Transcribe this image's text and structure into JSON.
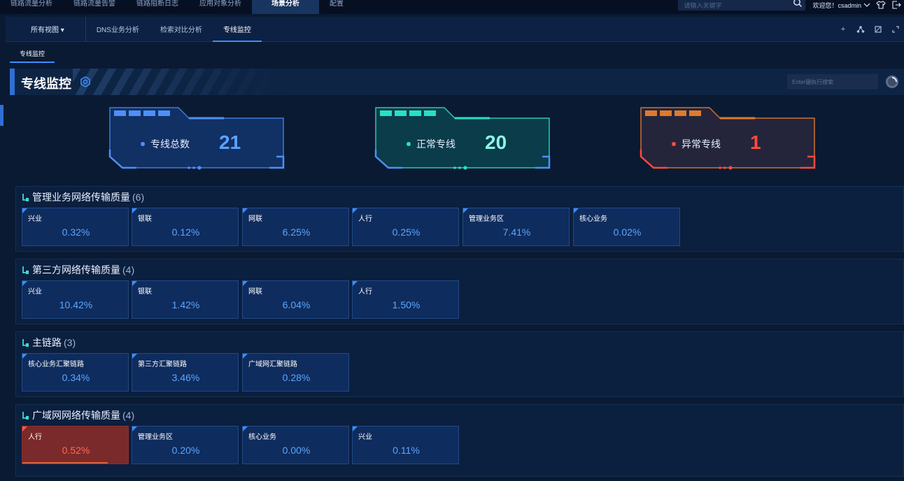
{
  "topnav": {
    "items": [
      "链路流量分析",
      "链路流量告警",
      "链路阻断日志",
      "应用对象分析",
      "场景分析",
      "配置"
    ],
    "active_index": 4,
    "search_placeholder": "请输入关键字",
    "welcome": "欢迎您！csadmin"
  },
  "viewbar": {
    "all_views": "所有视图 ▾",
    "tabs": [
      "DNS业务分析",
      "检索对比分析",
      "专线监控"
    ],
    "active_index": 2
  },
  "subtab": "专线监控",
  "page": {
    "title": "专线监控",
    "search_placeholder": "Enter键执行搜索"
  },
  "stats": [
    {
      "label": "专线总数",
      "value": "21",
      "color": "#4f8ff7",
      "value_color": "#5aa3ff",
      "fill": "#113063"
    },
    {
      "label": "正常专线",
      "value": "20",
      "color": "#27e0c7",
      "value_color": "#8bf5e6",
      "fill": "#0a3c49"
    },
    {
      "label": "异常专线",
      "value": "1",
      "color": "#e07a2c",
      "value_color": "#ff4a3d",
      "fill": "#24253b"
    }
  ],
  "groups": [
    {
      "title": "管理业务网络传输质量",
      "count": "(6)",
      "tiles": [
        {
          "name": "兴业",
          "value": "0.32%"
        },
        {
          "name": "银联",
          "value": "0.12%"
        },
        {
          "name": "网联",
          "value": "6.25%"
        },
        {
          "name": "人行",
          "value": "0.25%"
        },
        {
          "name": "管理业务区",
          "value": "7.41%"
        },
        {
          "name": "核心业务",
          "value": "0.02%"
        }
      ]
    },
    {
      "title": "第三方网络传输质量",
      "count": "(4)",
      "tiles": [
        {
          "name": "兴业",
          "value": "10.42%"
        },
        {
          "name": "银联",
          "value": "1.42%"
        },
        {
          "name": "网联",
          "value": "6.04%"
        },
        {
          "name": "人行",
          "value": "1.50%"
        }
      ]
    },
    {
      "title": "主链路",
      "count": "(3)",
      "tiles": [
        {
          "name": "核心业务汇聚链路",
          "value": "0.34%"
        },
        {
          "name": "第三方汇聚链路",
          "value": "3.46%"
        },
        {
          "name": "广域网汇聚链路",
          "value": "0.28%"
        }
      ]
    },
    {
      "title": "广域网网络传输质量",
      "count": "(4)",
      "tiles": [
        {
          "name": "人行",
          "value": "0.52%",
          "alert": true
        },
        {
          "name": "管理业务区",
          "value": "0.20%"
        },
        {
          "name": "核心业务",
          "value": "0.00%"
        },
        {
          "name": "兴业",
          "value": "0.11%"
        }
      ]
    }
  ]
}
